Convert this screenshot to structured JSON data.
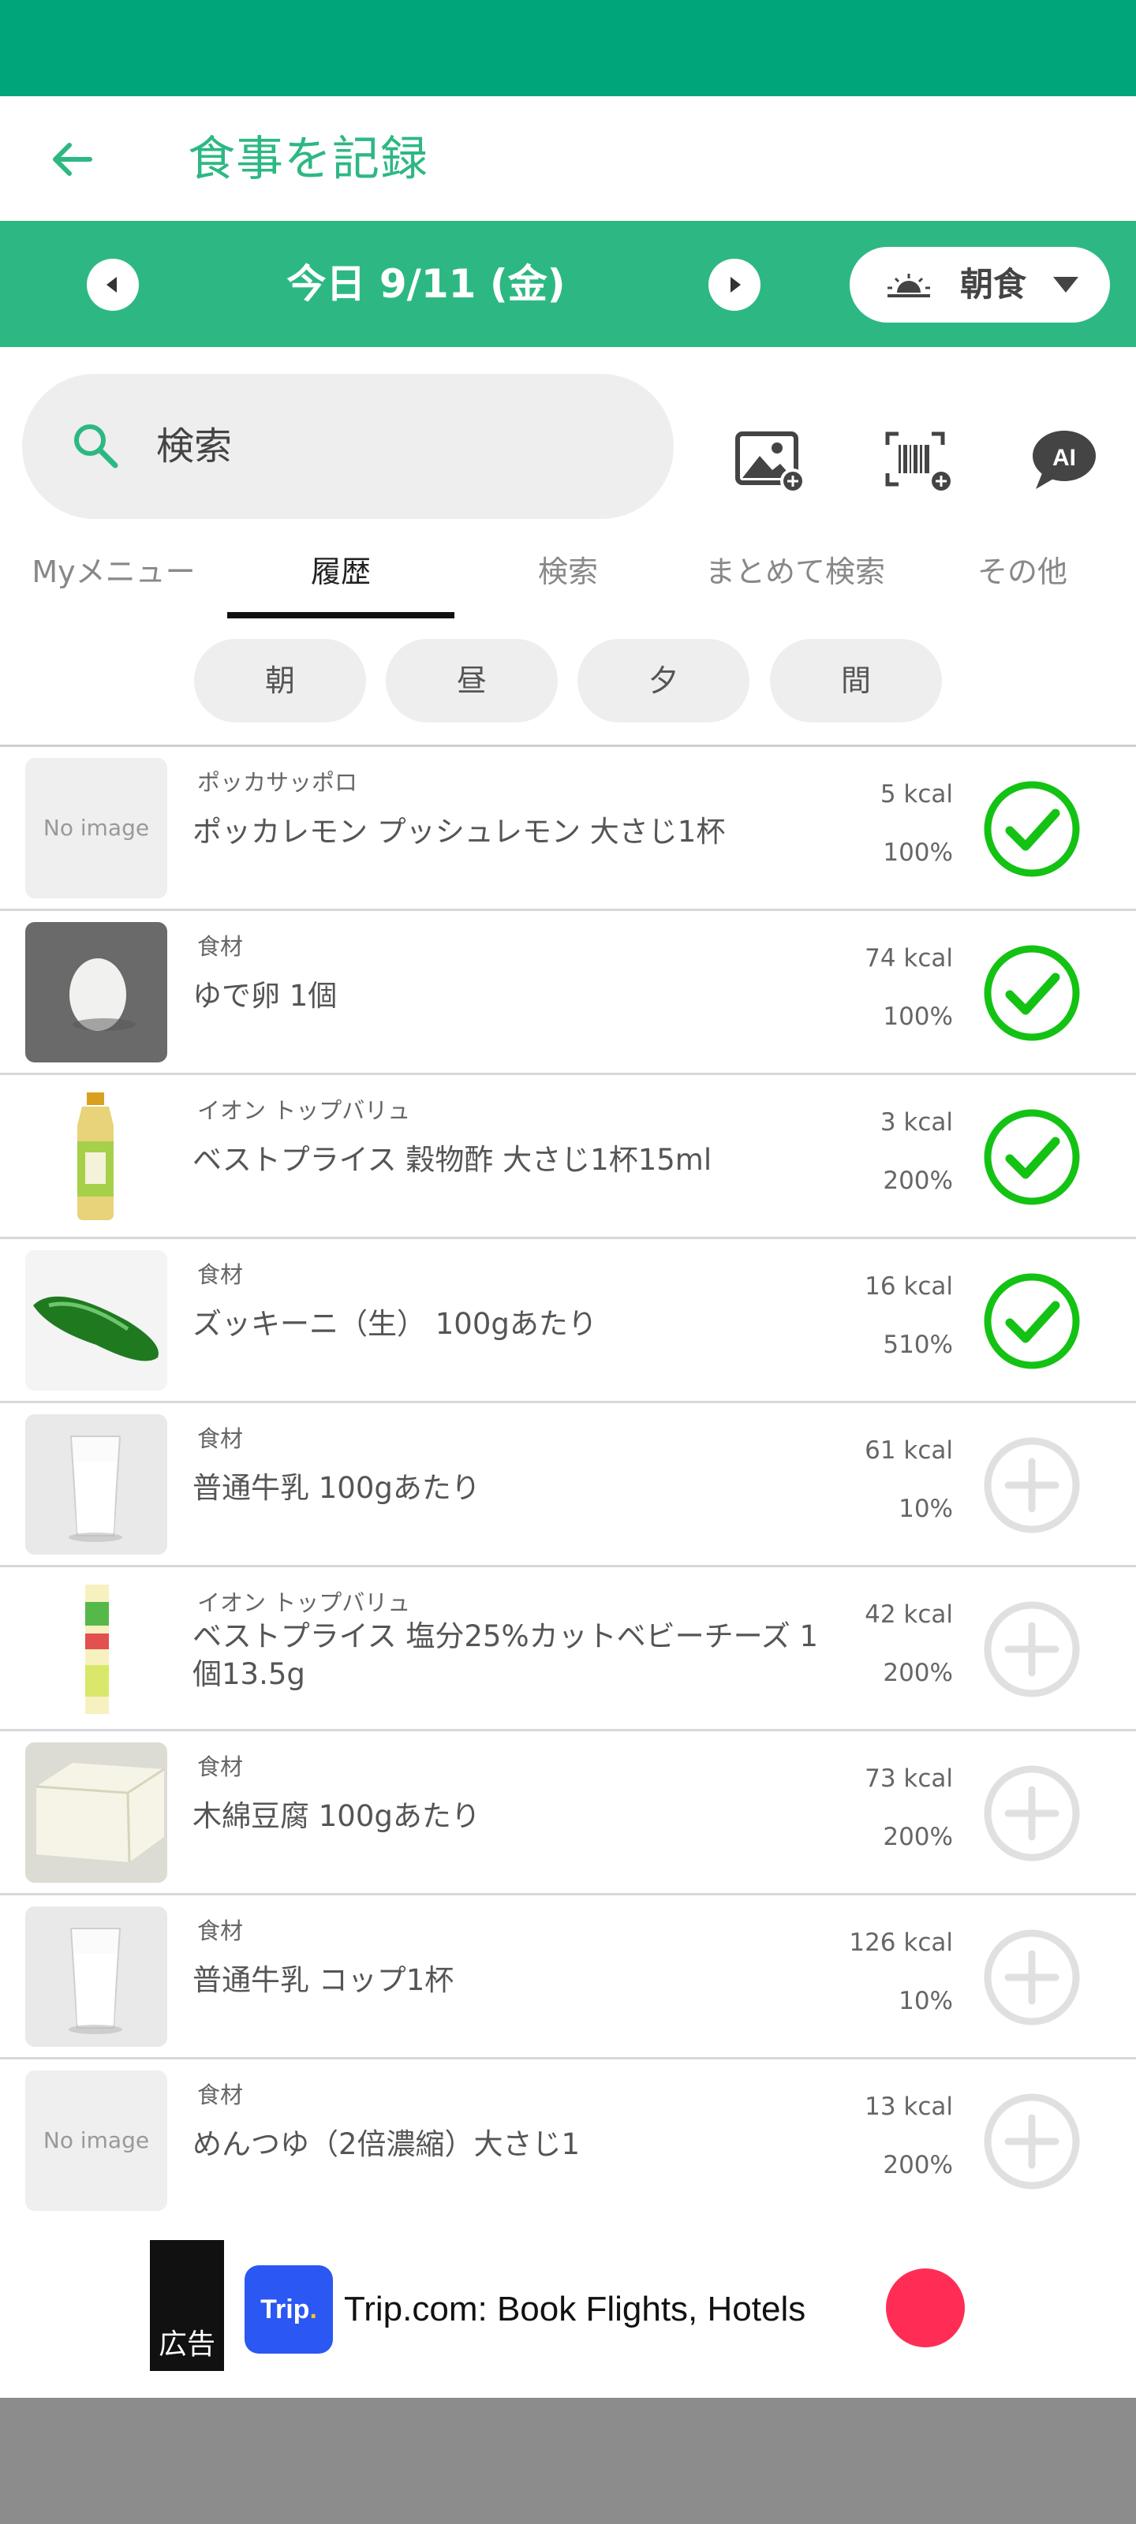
{
  "header": {
    "title": "食事を記録"
  },
  "date_bar": {
    "date": "今日 9/11 (金)",
    "meal": "朝食"
  },
  "search": {
    "placeholder": "検索"
  },
  "tabs": [
    {
      "label": "Myメニュー"
    },
    {
      "label": "履歴",
      "active": true
    },
    {
      "label": "検索"
    },
    {
      "label": "まとめて検索"
    },
    {
      "label": "その他"
    }
  ],
  "chips": [
    {
      "label": "朝"
    },
    {
      "label": "昼"
    },
    {
      "label": "夕"
    },
    {
      "label": "間"
    }
  ],
  "items": [
    {
      "brand": "ポッカサッポロ",
      "name": "ポッカレモン プッシュレモン 大さじ1杯",
      "kcal": "5 kcal",
      "pct": "100%",
      "added": true,
      "image": "no-image",
      "no_image_text": "No image"
    },
    {
      "brand": "食材",
      "name": "ゆで卵 1個",
      "kcal": "74 kcal",
      "pct": "100%",
      "added": true,
      "image": "egg"
    },
    {
      "brand": "イオン トップバリュ",
      "name": "ベストプライス 穀物酢 大さじ1杯15ml",
      "kcal": "3 kcal",
      "pct": "200%",
      "added": true,
      "image": "vinegar-bottle"
    },
    {
      "brand": "食材",
      "name": "ズッキーニ（生） 100gあたり",
      "kcal": "16 kcal",
      "pct": "510%",
      "added": true,
      "image": "zucchini"
    },
    {
      "brand": "食材",
      "name": "普通牛乳 100gあたり",
      "kcal": "61 kcal",
      "pct": "10%",
      "added": false,
      "image": "milk-glass"
    },
    {
      "brand": "イオン トップバリュ",
      "name": "ベストプライス 塩分25%カットベビーチーズ 1個13.5g",
      "kcal": "42 kcal",
      "pct": "200%",
      "added": false,
      "image": "cheese-pack"
    },
    {
      "brand": "食材",
      "name": "木綿豆腐 100gあたり",
      "kcal": "73 kcal",
      "pct": "200%",
      "added": false,
      "image": "tofu"
    },
    {
      "brand": "食材",
      "name": "普通牛乳 コップ1杯",
      "kcal": "126 kcal",
      "pct": "10%",
      "added": false,
      "image": "milk-glass"
    },
    {
      "brand": "食材",
      "name": "めんつゆ（2倍濃縮）大さじ1",
      "kcal": "13 kcal",
      "pct": "200%",
      "added": false,
      "image": "no-image",
      "no_image_text": "No image"
    }
  ],
  "ad": {
    "tag": "広告",
    "logo_text": "Trip",
    "logo_dot": ".",
    "text": "Trip.com: Book Flights, Hotels"
  },
  "colors": {
    "brand_green": "#2db883",
    "status_green": "#00a67a",
    "check_green": "#14c214",
    "plus_gray": "#e0e0e0"
  }
}
